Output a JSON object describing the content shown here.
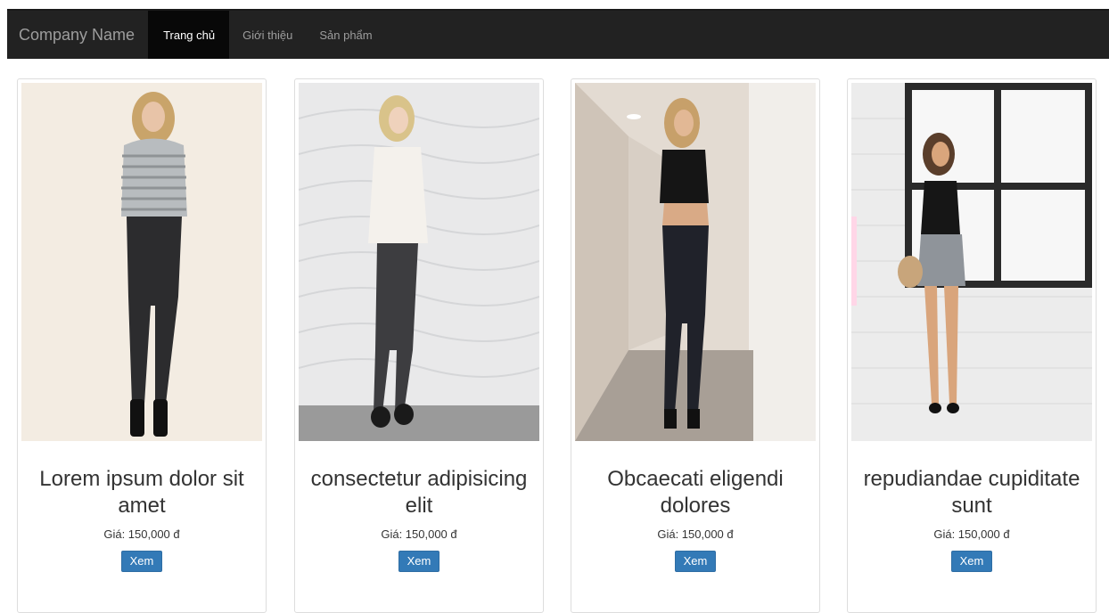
{
  "navbar": {
    "brand": "Company Name",
    "items": [
      {
        "label": "Trang chủ",
        "active": true
      },
      {
        "label": "Giới thiệu",
        "active": false
      },
      {
        "label": "Sản phẩm",
        "active": false
      }
    ]
  },
  "products": [
    {
      "title": "Lorem ipsum dolor sit amet",
      "price": "Giá: 150,000 đ",
      "button": "Xem"
    },
    {
      "title": "consectetur adipisicing elit",
      "price": "Giá: 150,000 đ",
      "button": "Xem"
    },
    {
      "title": "Obcaecati eligendi dolores",
      "price": "Giá: 150,000 đ",
      "button": "Xem"
    },
    {
      "title": "repudiandae cupiditate sunt",
      "price": "Giá: 150,000 đ",
      "button": "Xem"
    }
  ],
  "colors": {
    "navbar_bg": "#222222",
    "navbar_active_bg": "#080808",
    "button_primary": "#337ab7"
  }
}
